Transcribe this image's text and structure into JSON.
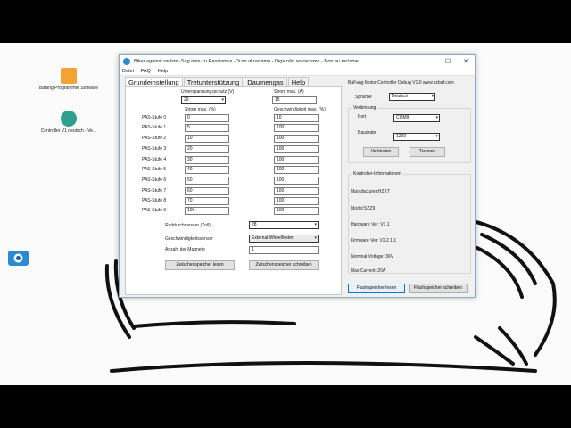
{
  "desktop_icons": [
    {
      "label": "Bafang Programmer Software"
    },
    {
      "label": "Controller V1 deutsch - Ve..."
    }
  ],
  "window": {
    "title": "Biker against racism -Sag nein zu Rassismus  -Di no al racismo - Diga não ao racismo - Non au racisme",
    "minimize": "—",
    "maximize": "☐",
    "close": "✕"
  },
  "menu": [
    "Datei",
    "FAQ",
    "Help"
  ],
  "tabs": [
    "Grundeinstellung",
    "Tretunterstützung",
    "Daumengas",
    "Help"
  ],
  "basic": {
    "undervoltage_label": "Unterspannungsschutz (V)",
    "undervoltage_value": "29",
    "current_max_label": "Strom max. (A)",
    "current_max_value": "15",
    "pas_current_header": "Strom max. (%)",
    "pas_speed_header": "Geschwindigkeit max. (%)",
    "pas_rows": [
      {
        "label": "PAS-Stufe 0",
        "current": "0",
        "speed": "10"
      },
      {
        "label": "PAS-Stufe 1",
        "current": "5",
        "speed": "100"
      },
      {
        "label": "PAS-Stufe 2",
        "current": "10",
        "speed": "100"
      },
      {
        "label": "PAS-Stufe 3",
        "current": "20",
        "speed": "100"
      },
      {
        "label": "PAS-Stufe 4",
        "current": "30",
        "speed": "100"
      },
      {
        "label": "PAS-Stufe 5",
        "current": "40",
        "speed": "100"
      },
      {
        "label": "PAS-Stufe 6",
        "current": "50",
        "speed": "100"
      },
      {
        "label": "PAS-Stufe 7",
        "current": "60",
        "speed": "100"
      },
      {
        "label": "PAS-Stufe 8",
        "current": "70",
        "speed": "100"
      },
      {
        "label": "PAS-Stufe 9",
        "current": "100",
        "speed": "100"
      }
    ],
    "wheel_label": "Raddurchmesser (Zoll)",
    "wheel_value": "28",
    "speedsensor_label": "Geschwindigkeitssensor",
    "speedsensor_value": "External,WheelMeter",
    "magnets_label": "Anzahl der Magnete",
    "magnets_value": "1",
    "read_button": "Zwischenspeicher lesen",
    "write_button": "Zwischenspeicher schreiben"
  },
  "right": {
    "header": "BaFang Motor Controller Debug V1.0   www.szbaf.com",
    "language_label": "Sprache",
    "language_value": "Deutsch",
    "connection_title": "Verbindung",
    "port_label": "Port",
    "port_value": "COM9",
    "baud_label": "Baudrate",
    "baud_value": "1200",
    "connect_button": "Verbinden",
    "disconnect_button": "Trennen",
    "info_title": "Kontroller-Informationen",
    "info_lines": [
      "Manufacturer:HZXT",
      "Model:SZZ9",
      "Hardware Ver: V1.1",
      "Firmware Ver: V2.2.1.1",
      "Nominal Voltage: 36V",
      "Max Current: 20A"
    ],
    "flash_read_button": "Flashspeicher lesen",
    "flash_write_button": "Flashspeicher schreiben"
  },
  "colors": {
    "accent": "#0078d7",
    "window_bg": "#f0f0f0",
    "app_icon": "#2a8ad6"
  }
}
